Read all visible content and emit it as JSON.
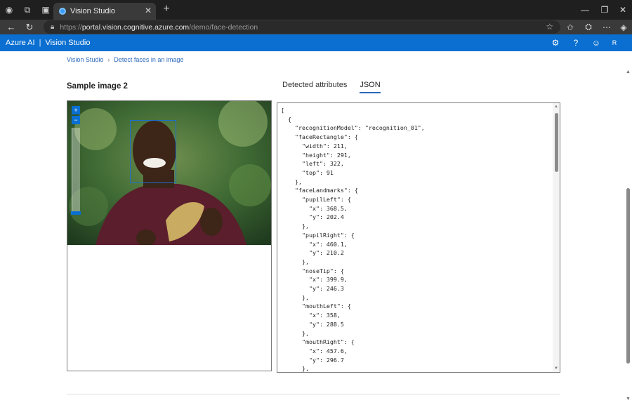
{
  "browser": {
    "tab_title": "Vision Studio",
    "url_scheme": "https://",
    "url_host": "portal.vision.cognitive.azure.com",
    "url_path": "/demo/face-detection"
  },
  "header": {
    "brand": "Azure AI",
    "separator": "|",
    "app": "Vision Studio",
    "avatar_initial": "R"
  },
  "breadcrumb": {
    "root": "Vision Studio",
    "current": "Detect faces in an image"
  },
  "main": {
    "section_title": "Sample image 2",
    "tabs": [
      {
        "label": "Detected attributes"
      },
      {
        "label": "JSON"
      }
    ],
    "active_tab": "JSON",
    "zoom_in": "+",
    "zoom_out": "−",
    "json_text": "[\n  {\n    \"recognitionModel\": \"recognition_01\",\n    \"faceRectangle\": {\n      \"width\": 211,\n      \"height\": 291,\n      \"left\": 322,\n      \"top\": 91\n    },\n    \"faceLandmarks\": {\n      \"pupilLeft\": {\n        \"x\": 368.5,\n        \"y\": 202.4\n      },\n      \"pupilRight\": {\n        \"x\": 460.1,\n        \"y\": 210.2\n      },\n      \"noseTip\": {\n        \"x\": 399.9,\n        \"y\": 246.3\n      },\n      \"mouthLeft\": {\n        \"x\": 358,\n        \"y\": 288.5\n      },\n      \"mouthRight\": {\n        \"x\": 457.6,\n        \"y\": 296.7\n      },"
  },
  "icons": {
    "tab_favicon": "vision-studio-icon",
    "settings": "gear-icon",
    "help": "question-icon",
    "feedback": "smiley-icon"
  }
}
